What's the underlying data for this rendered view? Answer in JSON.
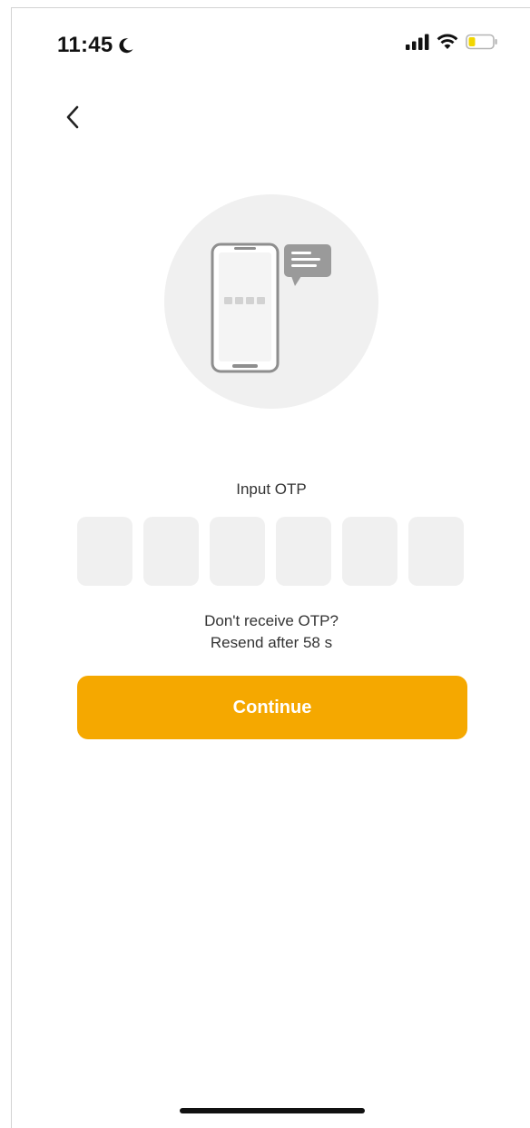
{
  "status_bar": {
    "time": "11:45",
    "icons": [
      "moon-icon",
      "signal-icon",
      "wifi-icon",
      "battery-icon"
    ],
    "battery_color": "#f2d600"
  },
  "nav": {
    "back_icon": "chevron-left-icon"
  },
  "otp": {
    "title": "Input OTP",
    "box_count": 6,
    "values": [
      "",
      "",
      "",
      "",
      "",
      ""
    ]
  },
  "resend": {
    "line1": "Don't receive OTP?",
    "line2": "Resend after 58 s"
  },
  "continue_button": {
    "label": "Continue",
    "color": "#f5a800"
  }
}
